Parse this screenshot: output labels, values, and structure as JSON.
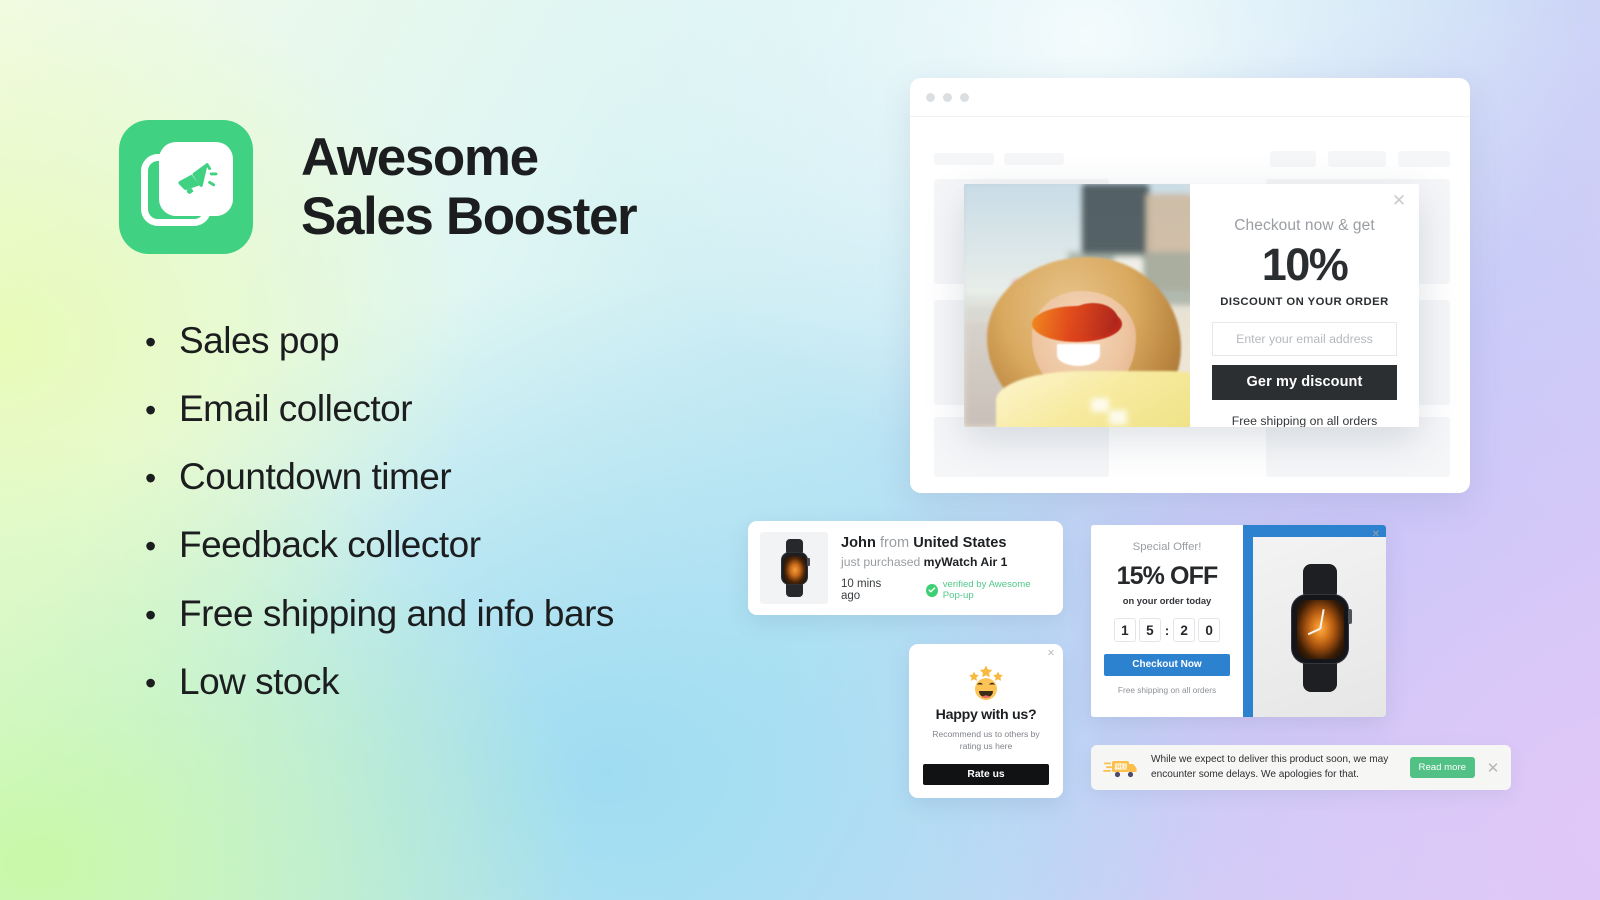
{
  "brand": {
    "title_line1": "Awesome",
    "title_line2": "Sales Booster",
    "logo_icon": "megaphone-icon",
    "accent_green": "#41d182"
  },
  "features": [
    {
      "bullet": "•",
      "label": "Sales pop"
    },
    {
      "bullet": "•",
      "label": "Email collector"
    },
    {
      "bullet": "•",
      "label": "Countdown timer"
    },
    {
      "bullet": "•",
      "label": "Feedback collector"
    },
    {
      "bullet": "•",
      "label": "Free shipping and info bars"
    },
    {
      "bullet": "•",
      "label": "Low stock"
    }
  ],
  "email_popup": {
    "close_icon": "✕",
    "kicker": "Checkout now & get",
    "discount": "10%",
    "subtitle": "DISCOUNT ON YOUR ORDER",
    "email_placeholder": "Enter your email address",
    "email_value": "",
    "button_label": "Ger my discount",
    "footer_note": "Free shipping on all orders",
    "button_color": "#2c2f32"
  },
  "sales_pop": {
    "customer": "John",
    "from_word": "from",
    "country": "United States",
    "action": "just purchased",
    "product": "myWatch Air 1",
    "time": "10 mins ago",
    "verified": "verified by Awesome Pop-up",
    "verified_color": "#52c98b",
    "product_icon": "smartwatch-icon"
  },
  "countdown": {
    "close_icon": "✕",
    "kicker": "Special Offer!",
    "headline": "15% OFF",
    "subtitle": "on your order today",
    "timer": [
      "1",
      "5",
      "2",
      "0"
    ],
    "timer_separator": ":",
    "button_label": "Checkout Now",
    "footer_note": "Free shipping on all orders",
    "accent_color": "#2d82d0",
    "product_icon": "smartwatch-icon"
  },
  "feedback": {
    "close_icon": "✕",
    "emoji_icon": "star-struck-face-icon",
    "title": "Happy with us?",
    "subtitle": "Recommend us to others by rating us here",
    "button_label": "Rate us",
    "button_color": "#111214"
  },
  "info_bar": {
    "icon": "free-delivery-truck-icon",
    "message": "While we expect to deliver this product soon, we may encounter some delays. We apologies for that.",
    "button_label": "Read more",
    "button_color": "#52c185",
    "close_icon": "✕"
  }
}
